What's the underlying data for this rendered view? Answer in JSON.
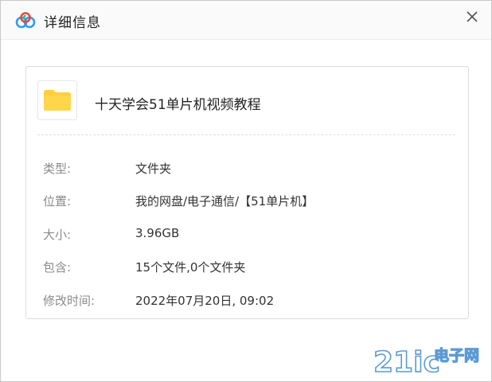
{
  "window": {
    "title": "详细信息",
    "app_icon": "baidu-netdisk-logo",
    "close_icon": "close-icon"
  },
  "file": {
    "icon": "folder-icon",
    "name": "十天学会51单片机视频教程"
  },
  "details": [
    {
      "label": "类型:",
      "value": "文件夹"
    },
    {
      "label": "位置:",
      "value": "我的网盘/电子通信/【51单片机】"
    },
    {
      "label": "大小:",
      "value": "3.96GB"
    },
    {
      "label": "包含:",
      "value": "15个文件,0个文件夹"
    },
    {
      "label": "修改时间:",
      "value": "2022年07月20日, 09:02"
    }
  ],
  "watermark": {
    "text": "21ic电子网"
  },
  "colors": {
    "folder": "#ffcf3f",
    "label": "#8a8a8a",
    "value": "#333333",
    "watermark": "#5b9bd5"
  }
}
